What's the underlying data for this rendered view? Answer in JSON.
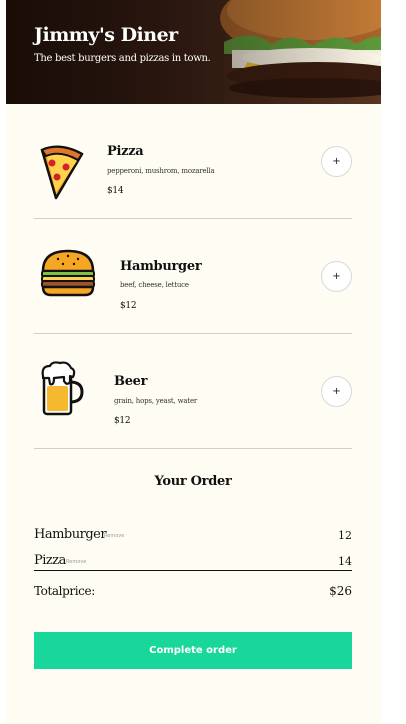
{
  "header": {
    "title": "Jimmy's Diner",
    "subtitle": "The best burgers and pizzas in town."
  },
  "menu": {
    "items": [
      {
        "icon": "pizza-icon",
        "name": "Pizza",
        "ingredients": "pepperoni, mushrom, mozarella",
        "price": "$14",
        "add_label": "+"
      },
      {
        "icon": "hamburger-icon",
        "name": "Hamburger",
        "ingredients": "beef, cheese, lettuce",
        "price": "$12",
        "add_label": "+"
      },
      {
        "icon": "beer-icon",
        "name": "Beer",
        "ingredients": "grain, hops, yeast, water",
        "price": "$12",
        "add_label": "+"
      }
    ]
  },
  "order": {
    "title": "Your Order",
    "items": [
      {
        "name": "Hamburger",
        "remove_label": "Remove",
        "price": "12"
      },
      {
        "name": "Pizza",
        "remove_label": "Remove",
        "price": "14"
      }
    ],
    "total_label": "Totalprice:",
    "total_value": "$26",
    "complete_label": "Complete order"
  },
  "colors": {
    "accent": "#19d69a",
    "background": "#fffdf3"
  }
}
